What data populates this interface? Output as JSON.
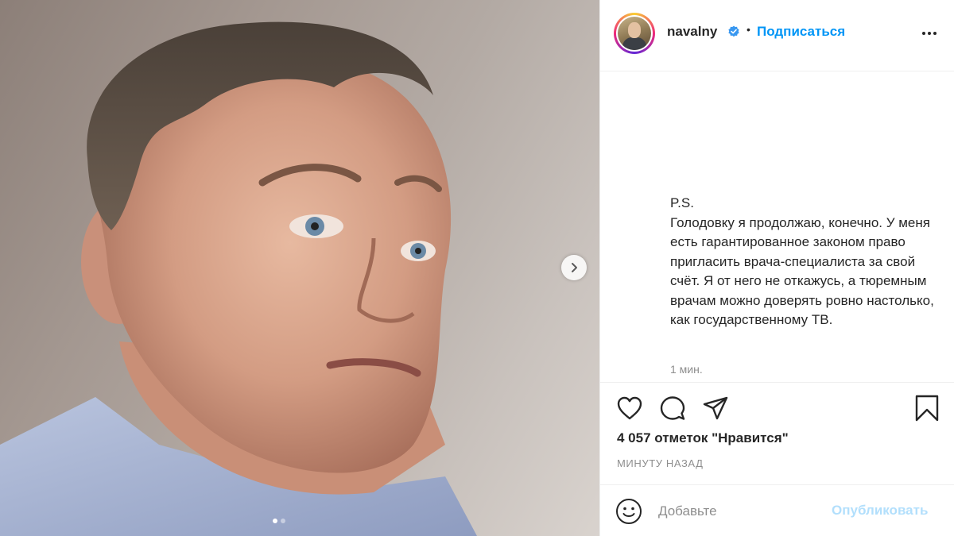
{
  "post": {
    "username": "navalny",
    "follow_label": "Подписаться",
    "separator": "•",
    "caption_lines": [
      "P.S.",
      "Голодовку я продолжаю, конечно. У меня есть гарантированное законом право пригласить врача-специалиста за свой счёт. Я от него не откажусь, а тюремным врачам можно доверять ровно настолько, как государственному ТВ."
    ],
    "caption_time": "1 мин.",
    "likes_text": "4 057 отметок \"Нравится\"",
    "timestamp": "МИНУТУ НАЗАД",
    "comment_placeholder": "Добавьте",
    "publish_label": "Опубликовать"
  },
  "carousel": {
    "slide_count": 2,
    "active_slide": 1
  },
  "icons": {
    "verified": "verified-badge-icon",
    "more": "more-options-icon",
    "like": "heart-icon",
    "comment": "comment-bubble-icon",
    "share": "paper-plane-icon",
    "save": "bookmark-icon",
    "emoji": "smiley-icon",
    "next": "chevron-right-icon"
  },
  "colors": {
    "accent": "#0095f6",
    "publish_disabled": "#b2dffc",
    "text": "#262626",
    "muted": "#8e8e8e",
    "border": "#efefef"
  }
}
